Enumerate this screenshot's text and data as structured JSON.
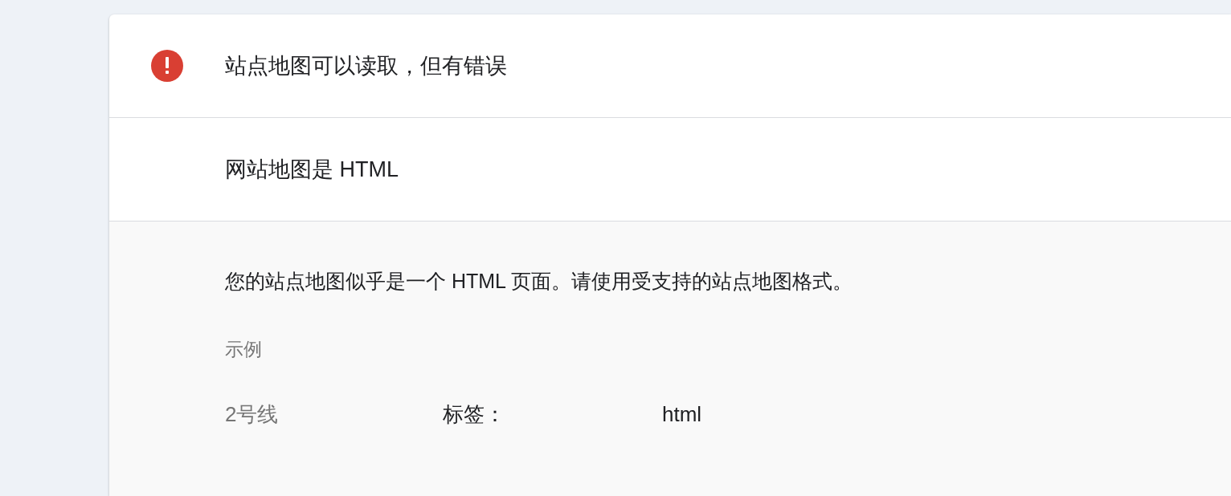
{
  "status": {
    "title": "站点地图可以读取，但有错误"
  },
  "issue": {
    "title": "网站地图是 HTML",
    "description": "您的站点地图似乎是一个 HTML 页面。请使用受支持的站点地图格式。",
    "examples_label": "示例",
    "example": {
      "line": "2号线",
      "tag_label": "标签：",
      "tag_value": "html"
    }
  }
}
